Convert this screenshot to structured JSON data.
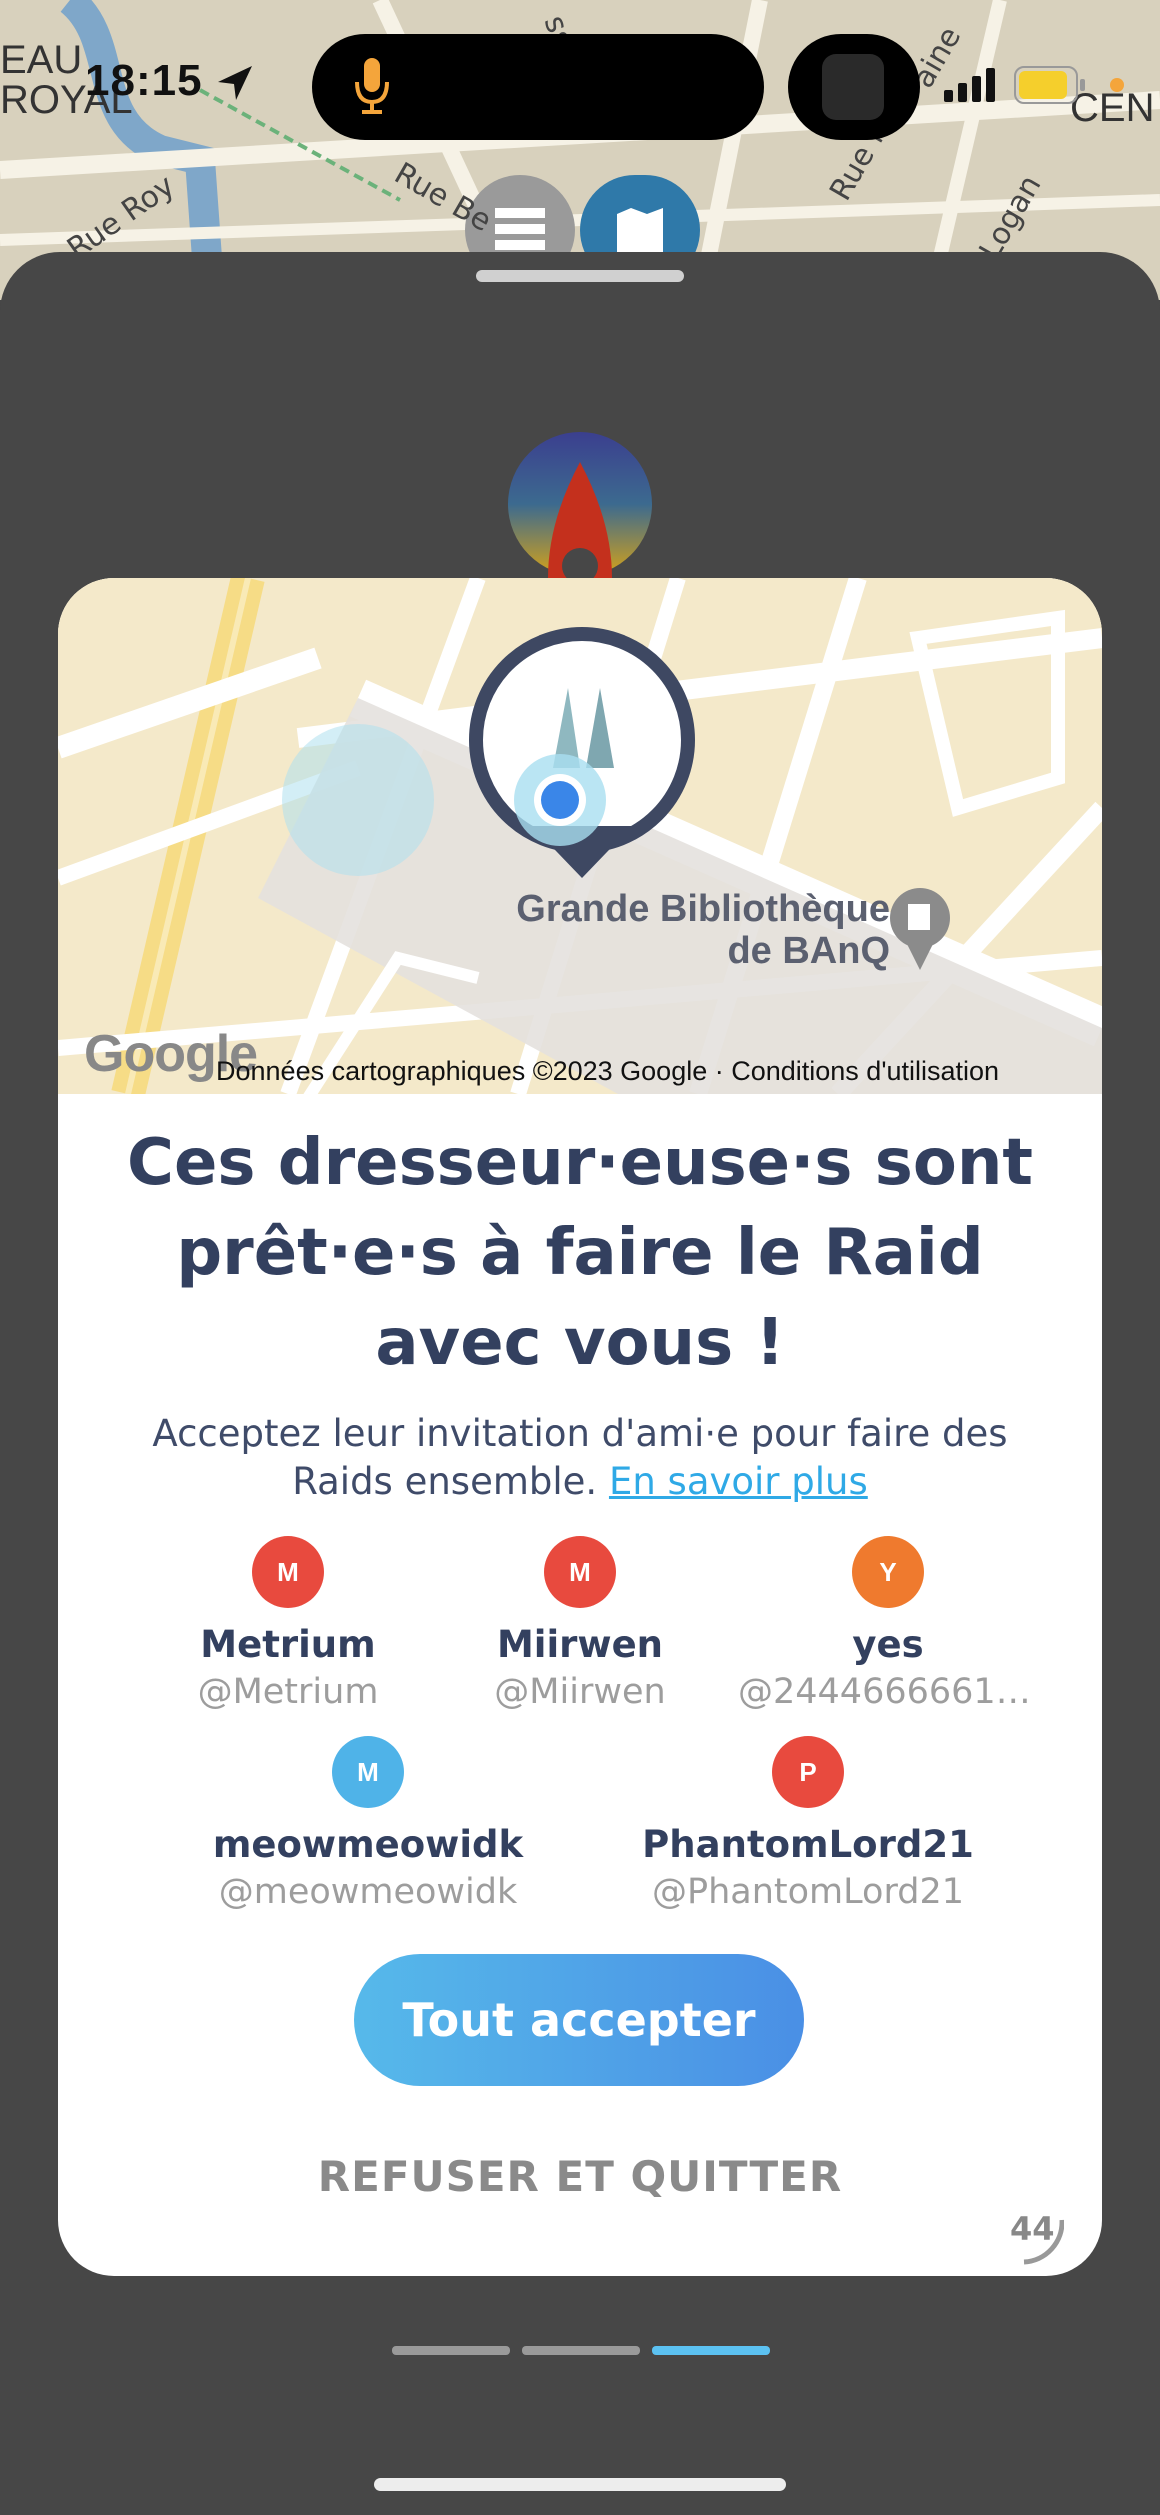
{
  "status_bar": {
    "time": "18:15"
  },
  "background_map": {
    "labels": [
      "EAU",
      "ROYAL",
      "Rue Roy",
      "Rue Be",
      "Rue la",
      "aine",
      "Logan",
      "CEN",
      "ssi"
    ]
  },
  "card": {
    "map": {
      "place_line1": "Grande Bibliothèque",
      "place_line2": "de BAnQ",
      "google_logo": "Google",
      "attribution": "Données cartographiques ©2023 Google · Conditions d'utilisation"
    },
    "title": "Ces dresseur·euse·s sont prêt·e·s à faire le Raid avec vous !",
    "subtitle": "Acceptez leur invitation d'ami·e pour faire des Raids ensemble.",
    "learn_more": "En savoir plus",
    "friends": [
      {
        "initial": "M",
        "name": "Metrium",
        "handle": "@Metrium",
        "color": "#e84a3e"
      },
      {
        "initial": "M",
        "name": "Miirwen",
        "handle": "@Miirwen",
        "color": "#e84a3e"
      },
      {
        "initial": "Y",
        "name": "yes",
        "handle": "@24446666612…",
        "color": "#ef7a2e"
      },
      {
        "initial": "M",
        "name": "meowmeowidk",
        "handle": "@meowmeowidk",
        "color": "#4fb3e8"
      },
      {
        "initial": "P",
        "name": "PhantomLord21",
        "handle": "@PhantomLord21",
        "color": "#e84a3e"
      }
    ],
    "accept_all": "Tout accepter",
    "refuse_quit": "REFUSER ET QUITTER",
    "corner_badge": "44"
  },
  "pager": {
    "total": 3,
    "active": 3
  }
}
